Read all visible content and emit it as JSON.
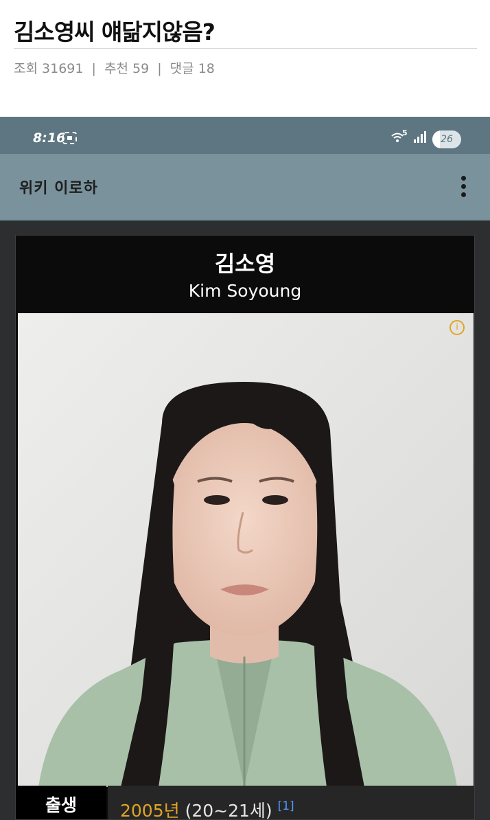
{
  "post": {
    "title": "김소영씨 얘닮지않음?",
    "views_label": "조회",
    "views": "31691",
    "recommend_label": "추천",
    "recommend": "59",
    "comments_label": "댓글",
    "comments": "18",
    "separator": "|"
  },
  "screenshot": {
    "status_bar": {
      "time": "8:16",
      "wifi_label": "5",
      "battery": "26",
      "battery_level": 0.26
    },
    "app_bar": {
      "title": "위키 이로하",
      "menu_icon": "kebab-menu-icon"
    },
    "infobox": {
      "name": "김소영",
      "name_en": "Kim Soyoung",
      "info_icon": "info-icon",
      "rows": [
        {
          "label": "출생",
          "year": "2005년",
          "age": " (20~21세)",
          "footnote": "[1]"
        }
      ]
    }
  },
  "colors": {
    "status_bar": "#5d7681",
    "app_bar": "#7a929c",
    "link_gold": "#e0a526",
    "footnote_blue": "#4f9bff",
    "infobox_bg": "#0b0b0b"
  }
}
